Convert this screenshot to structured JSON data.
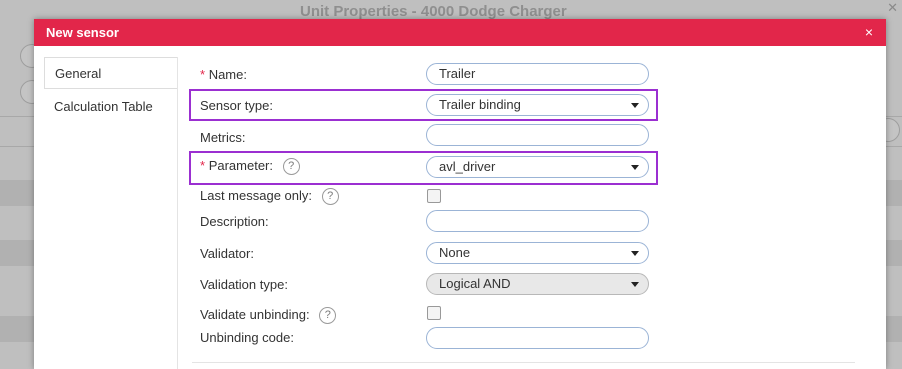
{
  "background": {
    "title": "Unit Properties - 4000 Dodge Charger"
  },
  "dialog": {
    "title": "New sensor",
    "close": "×",
    "accent_color": "#e2264a",
    "highlight_color": "#9b2fd1"
  },
  "tabs": [
    {
      "label": "General",
      "active": true
    },
    {
      "label": "Calculation Table",
      "active": false
    }
  ],
  "form": {
    "required_mark": "*",
    "help_glyph": "?",
    "name_label": "Name:",
    "name_value": "Trailer",
    "sensor_type_label": "Sensor type:",
    "sensor_type_value": "Trailer binding",
    "metrics_label": "Metrics:",
    "metrics_value": "",
    "parameter_label": "Parameter:",
    "parameter_value": "avl_driver",
    "last_message_label": "Last message only:",
    "last_message_checked": false,
    "description_label": "Description:",
    "description_value": "",
    "validator_label": "Validator:",
    "validator_value": "None",
    "validation_type_label": "Validation type:",
    "validation_type_value": "Logical AND",
    "validate_unbinding_label": "Validate unbinding:",
    "validate_unbinding_checked": false,
    "unbinding_code_label": "Unbinding code:",
    "unbinding_code_value": ""
  }
}
